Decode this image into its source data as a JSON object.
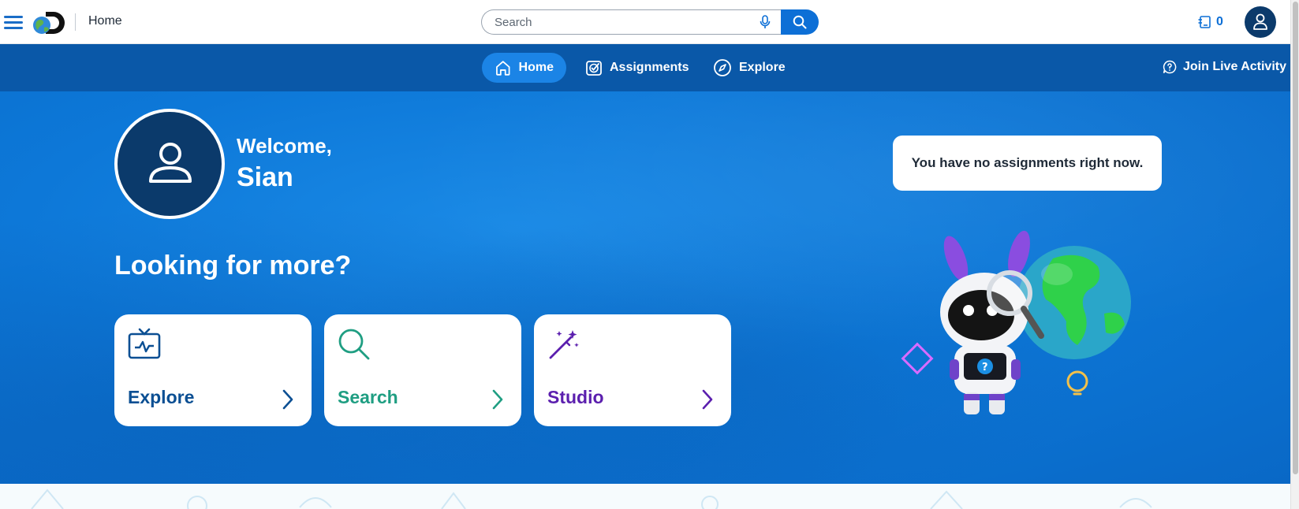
{
  "topbar": {
    "title": "Home",
    "search_placeholder": "Search",
    "counter_value": "0",
    "icons": {
      "menu": "hamburger-menu-icon",
      "logo": "discovery-education-logo",
      "mic": "microphone-icon",
      "search": "search-icon",
      "assignments_counter": "assignment-list-icon",
      "user": "user-icon"
    }
  },
  "nav": {
    "items": [
      {
        "label": "Home",
        "icon": "home-icon",
        "active": true
      },
      {
        "label": "Assignments",
        "icon": "assignment-check-icon",
        "active": false
      },
      {
        "label": "Explore",
        "icon": "compass-icon",
        "active": false
      }
    ],
    "join_live": {
      "label": "Join Live Activity",
      "icon": "question-bubble-icon"
    }
  },
  "hero": {
    "welcome": "Welcome,",
    "name": "Sian",
    "notice": "You have no assignments right now.",
    "looking": "Looking for more?",
    "cards": [
      {
        "label": "Explore",
        "icon": "tv-icon",
        "color": "#0b4f93"
      },
      {
        "label": "Search",
        "icon": "magnifier-icon",
        "color": "#1f9e82"
      },
      {
        "label": "Studio",
        "icon": "magic-wand-icon",
        "color": "#5b1fae"
      }
    ]
  },
  "colors": {
    "primary": "#0d6fd6",
    "nav_bg": "#0a58a8",
    "nav_active": "#1b84e6",
    "dark_navy": "#0b3a6b"
  }
}
